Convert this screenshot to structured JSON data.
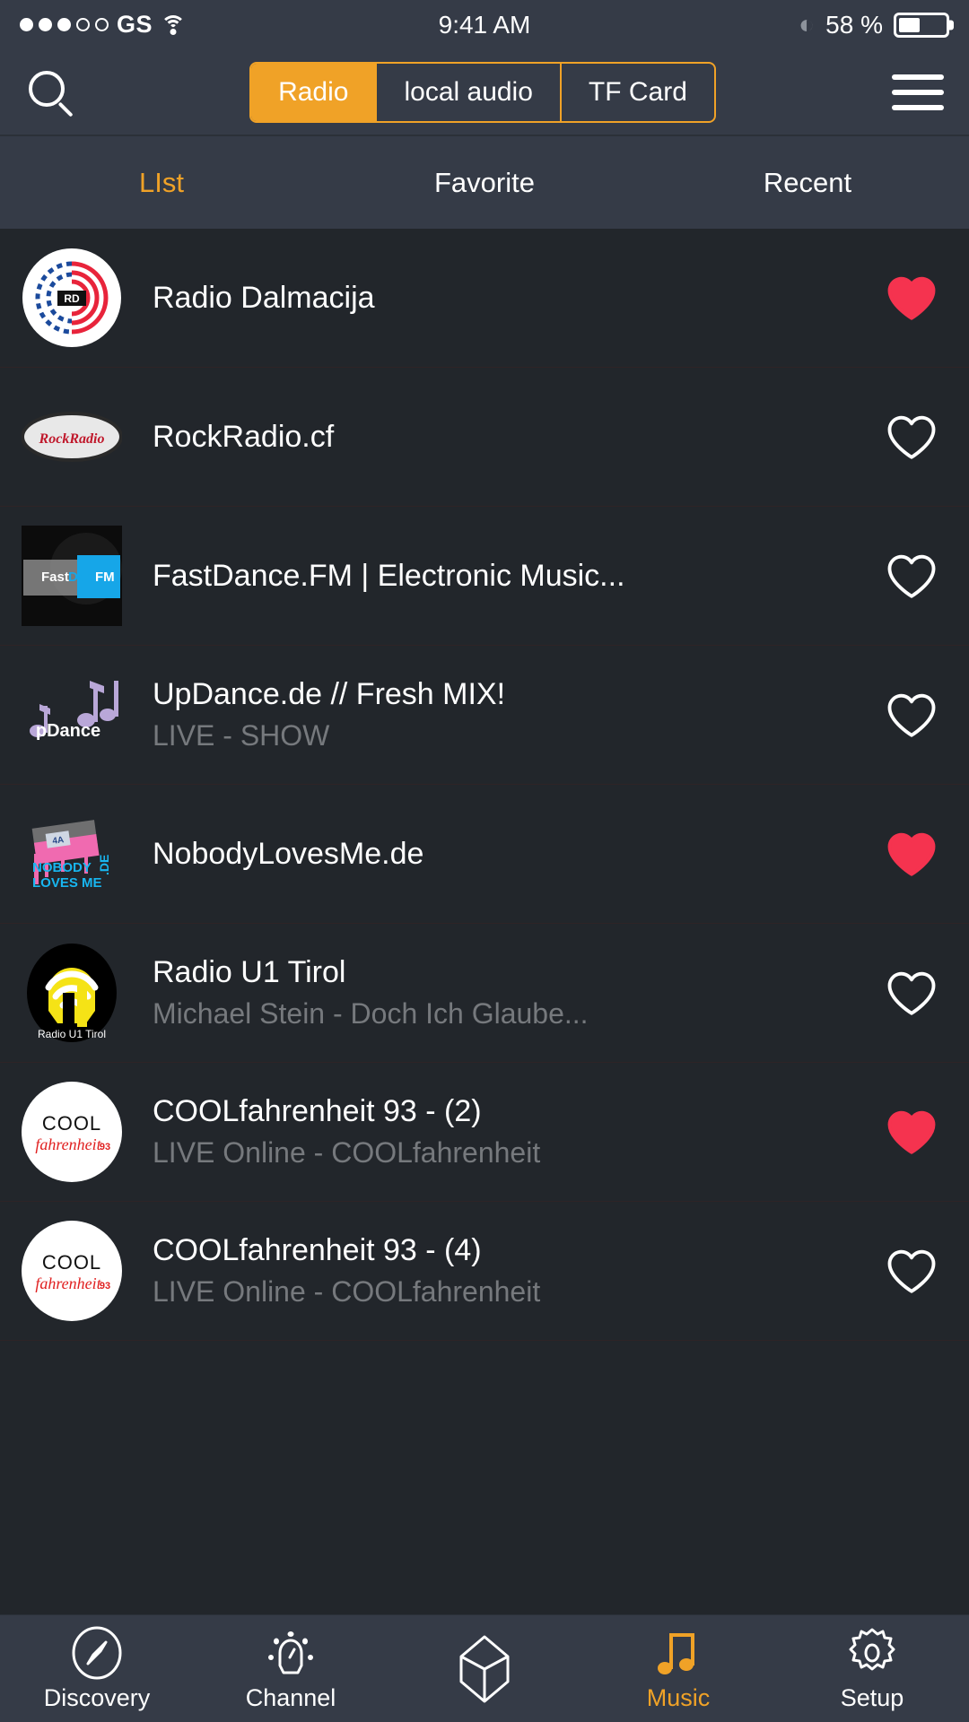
{
  "status_bar": {
    "signal_dots_filled": 3,
    "signal_dots_total": 5,
    "carrier": "GS",
    "wifi_icon": "wifi-icon",
    "time": "9:41 AM",
    "bluetooth_icon": "bluetooth-icon",
    "battery_percent": "58 %",
    "battery_level": 45
  },
  "header": {
    "search_icon": "search-icon",
    "menu_icon": "hamburger-menu-icon",
    "segments": [
      {
        "label": "Radio",
        "active": true
      },
      {
        "label": "local audio",
        "active": false
      },
      {
        "label": "TF Card",
        "active": false
      }
    ]
  },
  "subtabs": [
    {
      "label": "LIst",
      "active": true
    },
    {
      "label": "Favorite",
      "active": false
    },
    {
      "label": "Recent",
      "active": false
    }
  ],
  "stations": [
    {
      "title": "Radio Dalmacija",
      "subtitle": "",
      "favorite": true,
      "logo": "radio-dalmacija-logo"
    },
    {
      "title": "RockRadio.cf",
      "subtitle": "",
      "favorite": false,
      "logo": "rockradio-logo"
    },
    {
      "title": "FastDance.FM | Electronic Music...",
      "subtitle": "",
      "favorite": false,
      "logo": "fastdance-fm-logo"
    },
    {
      "title": "UpDance.de // Fresh MIX!",
      "subtitle": "LIVE - SHOW",
      "favorite": false,
      "logo": "updance-logo"
    },
    {
      "title": "NobodyLovesMe.de",
      "subtitle": "",
      "favorite": true,
      "logo": "nobodylovesme-logo"
    },
    {
      "title": "Radio U1 Tirol",
      "subtitle": "Michael Stein - Doch Ich Glaube...",
      "favorite": false,
      "logo": "radio-u1-tirol-logo"
    },
    {
      "title": "COOLfahrenheit 93 - (2)",
      "subtitle": "LIVE Online - COOLfahrenheit",
      "favorite": true,
      "logo": "coolfahrenheit-logo"
    },
    {
      "title": "COOLfahrenheit 93 - (4)",
      "subtitle": "LIVE Online - COOLfahrenheit",
      "favorite": false,
      "logo": "coolfahrenheit-logo"
    }
  ],
  "bottom_nav": [
    {
      "label": "Discovery",
      "icon": "compass-icon",
      "active": false
    },
    {
      "label": "Channel",
      "icon": "lamp-icon",
      "active": false
    },
    {
      "label": "",
      "icon": "cube-icon",
      "active": false
    },
    {
      "label": "Music",
      "icon": "music-note-icon",
      "active": true
    },
    {
      "label": "Setup",
      "icon": "gear-icon",
      "active": false
    }
  ],
  "colors": {
    "accent": "#f0a227",
    "heart_filled": "#f5334f",
    "header_bg": "#353b47",
    "list_bg": "#22262b",
    "subtitle_text": "#76797d"
  }
}
